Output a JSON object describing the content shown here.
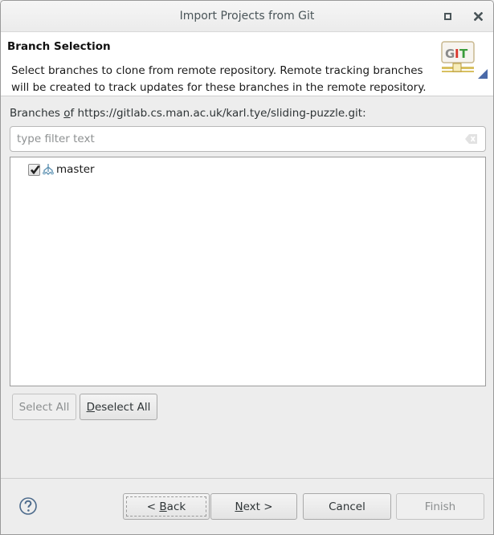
{
  "window": {
    "title": "Import Projects from Git",
    "maximize_icon": "maximize-icon",
    "close_icon": "close-icon"
  },
  "banner": {
    "title": "Branch Selection",
    "description": "Select branches to clone from remote repository. Remote tracking branches will be created to track updates for these branches in the remote repository.",
    "logo_text": "GIT"
  },
  "branches": {
    "label_prefix": "Branches ",
    "label_mnemonic": "o",
    "label_rest": "f https://gitlab.cs.man.ac.uk/karl.tye/sliding-puzzle.git:",
    "filter_placeholder": "type filter text",
    "filter_value": "",
    "items": [
      {
        "name": "master",
        "checked": true,
        "icon": "branch-icon"
      }
    ]
  },
  "selection_buttons": {
    "select_all": "Select All",
    "select_all_enabled": false,
    "deselect_mnemonic": "D",
    "deselect_rest": "eselect All"
  },
  "footer": {
    "help_icon": "help-icon",
    "back_prefix": "< ",
    "back_mnemonic": "B",
    "back_rest": "ack",
    "next_mnemonic": "N",
    "next_rest": "ext >",
    "cancel": "Cancel",
    "finish": "Finish",
    "finish_enabled": false
  }
}
